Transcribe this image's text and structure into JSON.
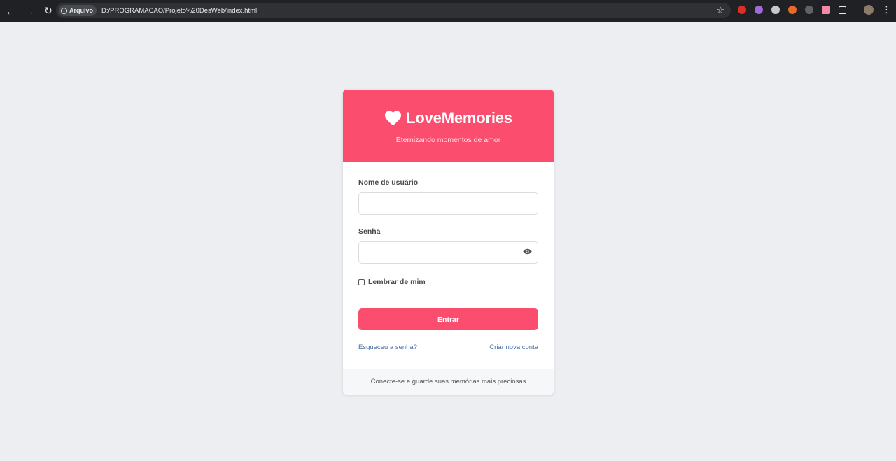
{
  "browser": {
    "security_chip": "Arquivo",
    "url": "D:/PROGRAMACAO/Projeto%20DesWeb/index.html",
    "icons": [
      "back-icon",
      "forward-icon",
      "reload-icon",
      "info-icon",
      "star-icon",
      "extensions-icon",
      "menu-icon"
    ]
  },
  "header": {
    "brand": "LoveMemories",
    "subtitle": "Eternizando momentos de amor"
  },
  "form": {
    "username_label": "Nome de usuário",
    "username_value": "",
    "password_label": "Senha",
    "password_value": "",
    "remember_label": "Lembrar de mim",
    "remember_checked": false,
    "submit_label": "Entrar",
    "forgot_link": "Esqueceu a senha?",
    "signup_link": "Criar nova conta"
  },
  "footer": {
    "text": "Conecte-se e guarde suas memórias mais preciosas"
  },
  "colors": {
    "accent": "#fb4d6d",
    "link": "#4a6fa5",
    "background": "#edeef1"
  }
}
